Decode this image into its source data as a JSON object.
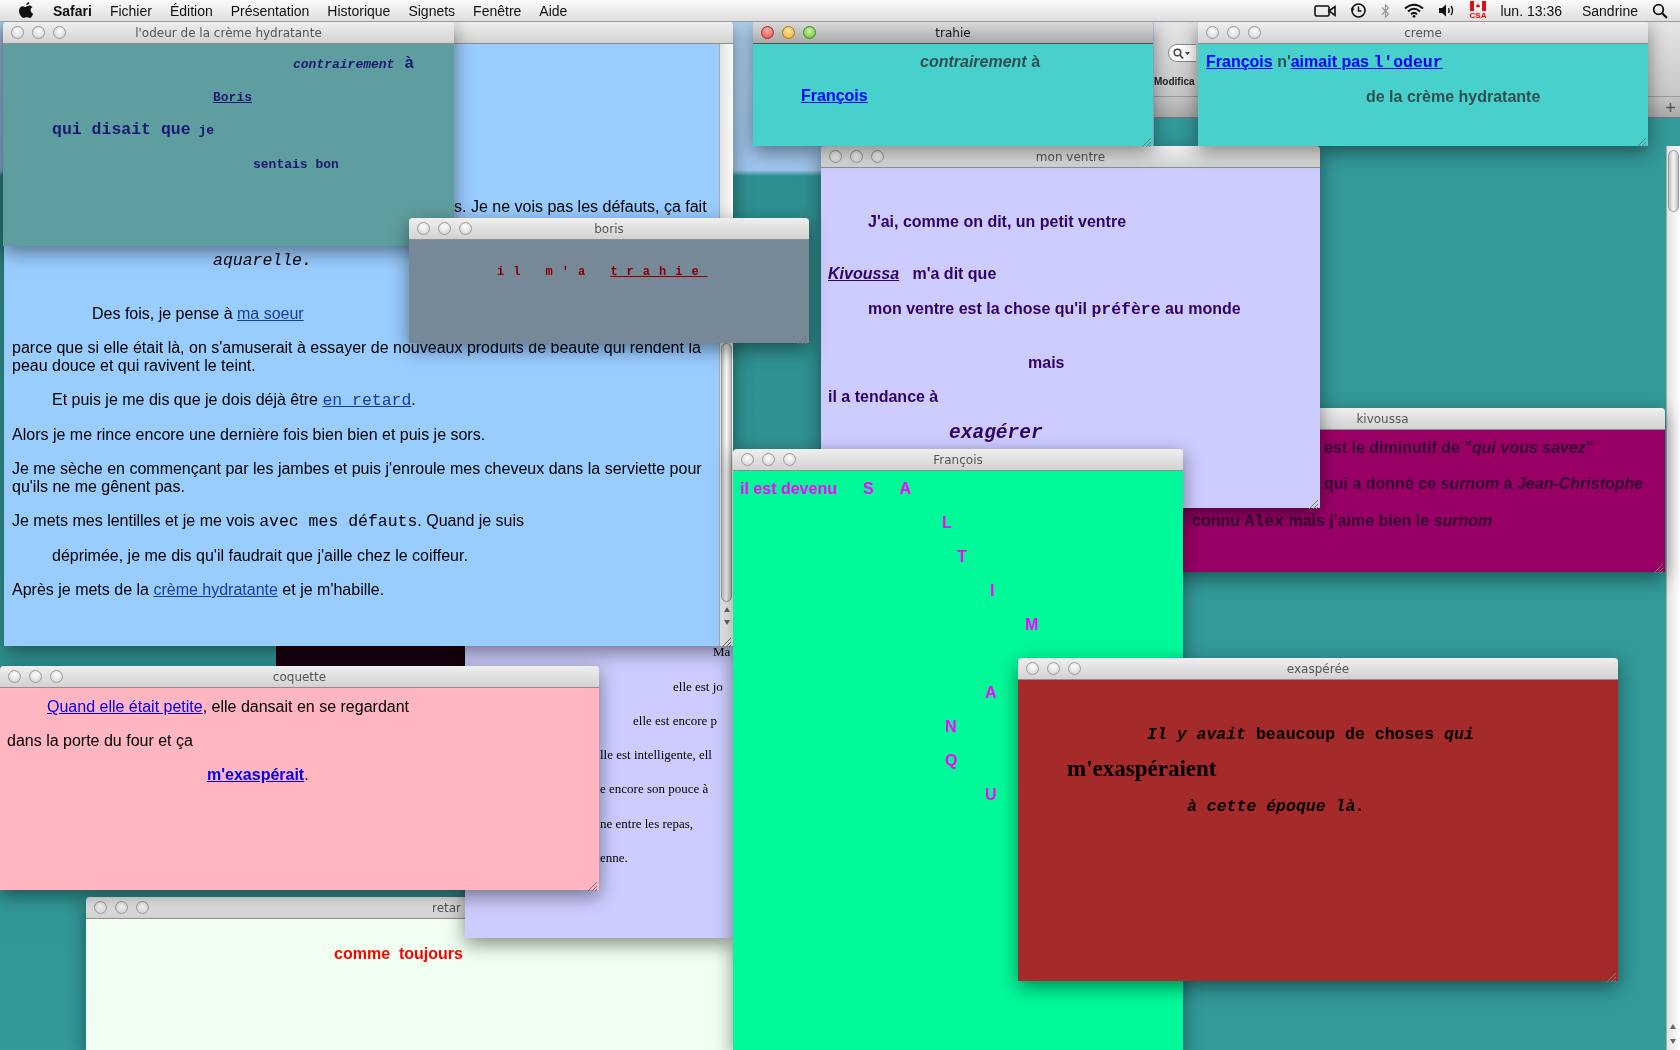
{
  "menu_bar": {
    "app": "Safari",
    "menus": [
      "Fichier",
      "Édition",
      "Présentation",
      "Historique",
      "Signets",
      "Fenêtre",
      "Aide"
    ],
    "input_source": "CSA",
    "clock": "lun. 13:36",
    "user": "Sandrine"
  },
  "background_window": {
    "toolbar_label": "Modifica"
  },
  "windows": [
    {
      "color": "#99ccff",
      "lines": [
        {
          "segments": [
            {
              "text": "s. Je ne vois pas les défauts, ça fait",
              "kind": "text"
            }
          ]
        },
        {
          "segments": [
            {
              "text": "aquarelle.",
              "kind": "code-italic"
            }
          ]
        },
        {
          "segments": [
            {
              "text": "Des fois, je pense à ",
              "kind": "text"
            },
            {
              "text": "ma soeur",
              "kind": "link"
            }
          ]
        },
        {
          "segments": [
            {
              "text": "parce que si elle était là, on s'amuserait à essayer de nouveaux produits de beauté qui rendent la peau douce et qui ravivent le teint.",
              "kind": "text"
            }
          ]
        },
        {
          "segments": [
            {
              "text": "Et puis je me dis que je dois déjà être ",
              "kind": "text"
            },
            {
              "text": "en retard",
              "kind": "code-link"
            },
            {
              "text": ".",
              "kind": "text"
            }
          ]
        },
        {
          "segments": [
            {
              "text": "Alors je me rince encore une dernière fois bien bien et puis je sors.",
              "kind": "text"
            }
          ]
        },
        {
          "segments": [
            {
              "text": "Je me sèche en commençant par les jambes et puis j'enroule mes cheveux dans la serviette pour qu'ils ne me gênent pas.",
              "kind": "text"
            }
          ]
        },
        {
          "segments": [
            {
              "text": "Je mets mes lentilles et je me vois ",
              "kind": "text"
            },
            {
              "text": "avec mes défauts",
              "kind": "code"
            },
            {
              "text": ". Quand je suis",
              "kind": "text"
            }
          ]
        },
        {
          "segments": [
            {
              "text": "déprimée, je me dis qu'il faudrait que j'aille chez le coiffeur.",
              "kind": "text"
            }
          ]
        },
        {
          "segments": [
            {
              "text": "Après je mets de la ",
              "kind": "text"
            },
            {
              "text": "crème hydratante",
              "kind": "link"
            },
            {
              "text": " et je m'habille.",
              "kind": "text"
            }
          ]
        }
      ]
    },
    {
      "title": "l'odeur de la crème hydratante",
      "active": false,
      "color": "#5f9ea0",
      "lines": [
        {
          "segments": [
            {
              "text": "contrairement",
              "kind": "italic"
            },
            {
              "text": " à",
              "kind": "large"
            }
          ]
        },
        {
          "segments": [
            {
              "text": "Boris",
              "kind": "link"
            }
          ]
        },
        {
          "segments": [
            {
              "text": "qui disait que",
              "kind": "large"
            },
            {
              "text": " je",
              "kind": "text"
            }
          ]
        },
        {
          "segments": [
            {
              "text": "sentais bon",
              "kind": "text"
            }
          ]
        }
      ]
    },
    {
      "title": "boris",
      "active": false,
      "color": "#778899",
      "lines": [
        {
          "segments": [
            {
              "text": "il m'a ",
              "kind": "text"
            },
            {
              "text": "trahie",
              "kind": "link"
            }
          ]
        }
      ]
    },
    {
      "title": "trahie",
      "active": true,
      "color": "#48d1cc",
      "lines": [
        {
          "segments": [
            {
              "text": "contrairement",
              "kind": "italic"
            },
            {
              "text": " à",
              "kind": "text"
            }
          ]
        },
        {
          "segments": [
            {
              "text": "François",
              "kind": "link"
            }
          ]
        }
      ]
    },
    {
      "title": "creme",
      "active": false,
      "color": "#48d1cc",
      "lines": [
        {
          "segments": [
            {
              "text": "François",
              "kind": "link"
            },
            {
              "text": " n'",
              "kind": "text"
            },
            {
              "text": "aimait pas ",
              "kind": "link"
            },
            {
              "text": "l'odeur",
              "kind": "code-link"
            }
          ]
        },
        {
          "segments": [
            {
              "text": "de la crème hydratante",
              "kind": "text"
            }
          ]
        }
      ]
    },
    {
      "title": "mon ventre",
      "active": false,
      "color": "#ccccff",
      "lines": [
        {
          "segments": [
            {
              "text": "J'ai, comme on dit, un petit ventre",
              "kind": "text"
            }
          ]
        },
        {
          "segments": [
            {
              "text": "Kivoussa",
              "kind": "italic-link"
            },
            {
              "text": "   m'a dit que",
              "kind": "text"
            }
          ]
        },
        {
          "segments": [
            {
              "text": "mon ventre est la chose qu'il ",
              "kind": "text"
            },
            {
              "text": "préfère",
              "kind": "code"
            },
            {
              "text": " au monde",
              "kind": "text"
            }
          ]
        },
        {
          "segments": [
            {
              "text": "mais",
              "kind": "text"
            }
          ]
        },
        {
          "segments": [
            {
              "text": "il a tendance à",
              "kind": "text"
            }
          ]
        },
        {
          "segments": [
            {
              "text": "exagérer",
              "kind": "code-italic-large"
            }
          ]
        }
      ]
    },
    {
      "title": "kivoussa",
      "active": false,
      "color": "#990066",
      "lines": [
        {
          "segments": [
            {
              "text": "est le diminutif de \"",
              "kind": "text"
            },
            {
              "text": "qui vous savez",
              "kind": "italic"
            },
            {
              "text": "\"",
              "kind": "text"
            }
          ]
        },
        {
          "segments": [
            {
              "text": "qui a donné ce ",
              "kind": "text"
            },
            {
              "text": "surnom",
              "kind": "italic"
            },
            {
              "text": " à ",
              "kind": "text"
            },
            {
              "text": "Jean-Christophe",
              "kind": "italic"
            }
          ]
        },
        {
          "segments": [
            {
              "text": "connu ",
              "kind": "text"
            },
            {
              "text": "Alex",
              "kind": "code"
            },
            {
              "text": " mais j'aime bien le ",
              "kind": "text"
            },
            {
              "text": "surnom",
              "kind": "italic"
            }
          ]
        }
      ]
    },
    {
      "title": "François",
      "active": false,
      "color": "#00fa9a",
      "lines": [
        {
          "segments": [
            {
              "text": "il est devenu",
              "kind": "text"
            },
            {
              "text": "S",
              "kind": "text"
            },
            {
              "text": "A",
              "kind": "text"
            }
          ]
        },
        {
          "segments": [
            {
              "text": "L",
              "kind": "text"
            }
          ]
        },
        {
          "segments": [
            {
              "text": "T",
              "kind": "text"
            }
          ]
        },
        {
          "segments": [
            {
              "text": "I",
              "kind": "text"
            }
          ]
        },
        {
          "segments": [
            {
              "text": "M",
              "kind": "text"
            }
          ]
        },
        {
          "segments": [
            {
              "text": "A",
              "kind": "text"
            }
          ]
        },
        {
          "segments": [
            {
              "text": "N",
              "kind": "text"
            }
          ]
        },
        {
          "segments": [
            {
              "text": "Q",
              "kind": "text"
            }
          ]
        },
        {
          "segments": [
            {
              "text": "U",
              "kind": "text"
            }
          ]
        }
      ]
    },
    {
      "title": "exaspérée",
      "active": false,
      "color": "#a52a2a",
      "lines": [
        {
          "segments": [
            {
              "text": "Il y avait",
              "kind": "italic"
            },
            {
              "text": " beaucoup de choses ",
              "kind": "text"
            },
            {
              "text": "qui",
              "kind": "italic"
            }
          ]
        },
        {
          "segments": [
            {
              "text": "m'exaspéraient",
              "kind": "serif-large"
            }
          ]
        },
        {
          "segments": [
            {
              "text": "à cette époque là.",
              "kind": "italic"
            }
          ]
        }
      ]
    },
    {
      "title": "coquette",
      "active": false,
      "color": "#ffb6c1",
      "lines": [
        {
          "segments": [
            {
              "text": "Quand elle était petite",
              "kind": "link"
            },
            {
              "text": ", elle dansait en se regardant",
              "kind": "text"
            }
          ]
        },
        {
          "segments": [
            {
              "text": "dans la porte du four et ça",
              "kind": "text"
            }
          ]
        },
        {
          "segments": [
            {
              "text": "m'exaspérait",
              "kind": "bold-link"
            },
            {
              "text": ".",
              "kind": "text"
            }
          ]
        }
      ]
    },
    {
      "title": "retar",
      "active": false,
      "color": "#f0fff0",
      "lines": [
        {
          "segments": [
            {
              "text": "comme  toujours",
              "kind": "text"
            }
          ]
        }
      ]
    },
    {
      "color": "#ccccff",
      "lines": [
        {
          "segments": [
            {
              "text": "Ma",
              "kind": "text"
            }
          ]
        },
        {
          "segments": [
            {
              "text": "elle est jo",
              "kind": "text"
            }
          ]
        },
        {
          "segments": [
            {
              "text": "elle est encore p",
              "kind": "text"
            }
          ]
        },
        {
          "segments": [
            {
              "text": "lle est intelligente, ell",
              "kind": "text"
            }
          ]
        },
        {
          "segments": [
            {
              "text": "e encore son pouce à",
              "kind": "text"
            }
          ]
        },
        {
          "segments": [
            {
              "text": "ne entre les repas,",
              "kind": "text"
            }
          ]
        },
        {
          "segments": [
            {
              "text": "enne.",
              "kind": "text"
            }
          ]
        }
      ]
    }
  ]
}
